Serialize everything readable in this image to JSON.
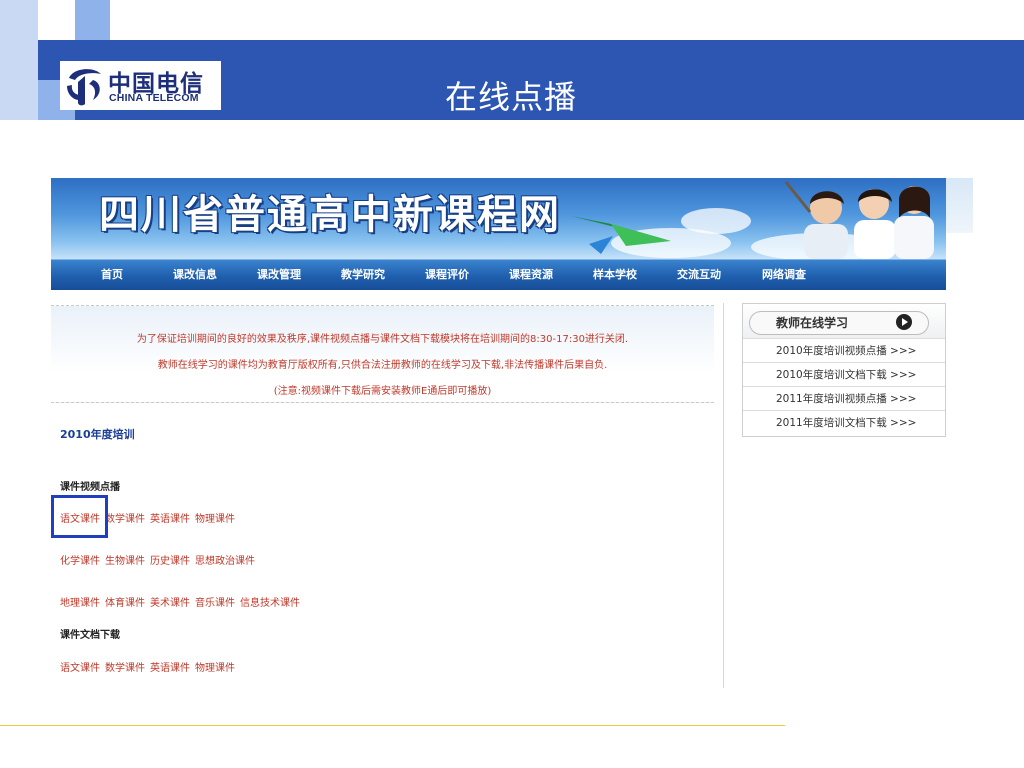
{
  "slide": {
    "title": "在线点播",
    "logo": {
      "cn": "中国电信",
      "en": "CHINA TELECOM"
    },
    "colors": {
      "band": "#2c56b2",
      "accent_light": "#8fb2ea",
      "rule": "#f2cc3c"
    }
  },
  "website": {
    "banner_title": "四川省普通高中新课程网",
    "nav": [
      "首页",
      "课改信息",
      "课改管理",
      "教学研究",
      "课程评价",
      "课程资源",
      "样本学校",
      "交流互动",
      "网络调查"
    ],
    "notice": [
      "为了保证培训期间的良好的效果及秩序,课件视频点播与课件文档下载模块将在培训期间的8:30-17:30进行关闭.",
      "教师在线学习的课件均为教育厅版权所有,只供合法注册教师的在线学习及下载,非法传播课件后果自负.",
      "(注意:视频课件下载后需安装教师E通后即可播放)"
    ],
    "section_title": "2010年度培训",
    "video": {
      "title": "课件视频点播",
      "rows": [
        [
          "语文课件",
          "数学课件",
          "英语课件",
          "物理课件"
        ],
        [
          "化学课件",
          "生物课件",
          "历史课件",
          "思想政治课件"
        ],
        [
          "地理课件",
          "体育课件",
          "美术课件",
          "音乐课件",
          "信息技术课件"
        ]
      ]
    },
    "docs": {
      "title": "课件文档下载",
      "rows": [
        [
          "语文课件",
          "数学课件",
          "英语课件",
          "物理课件"
        ]
      ]
    },
    "sidebar": {
      "heading": "教师在线学习",
      "play_icon": "play-circle-icon",
      "items": [
        "2010年度培训视频点播 >>>",
        "2010年度培训文档下载 >>>",
        "2011年度培训视频点播 >>>",
        "2011年度培训文档下载 >>>"
      ]
    },
    "colors": {
      "link": "#c0392b",
      "section": "#1b3f96",
      "nav": "#1f5fae"
    }
  }
}
